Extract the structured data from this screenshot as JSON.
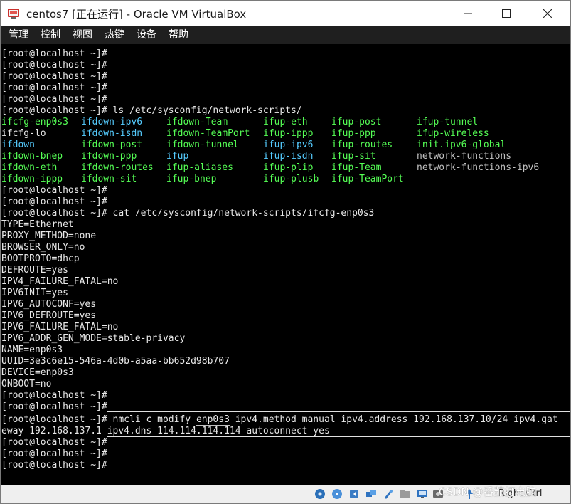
{
  "window": {
    "title": "centos7 [正在运行] - Oracle VM VirtualBox"
  },
  "menu": [
    "管理",
    "控制",
    "视图",
    "热键",
    "设备",
    "帮助"
  ],
  "terminal": {
    "prompt": "[root@localhost ~]#",
    "cmd_ls": "[root@localhost ~]# ls /etc/sysconfig/network-scripts/",
    "ls_rows": [
      [
        "ifcfg-enp0s3",
        "ifdown-ipv6",
        "ifdown-Team",
        "ifup-eth",
        "ifup-post",
        "ifup-tunnel"
      ],
      [
        "ifcfg-lo",
        "ifdown-isdn",
        "ifdown-TeamPort",
        "ifup-ippp",
        "ifup-ppp",
        "ifup-wireless"
      ],
      [
        "ifdown",
        "ifdown-post",
        "ifdown-tunnel",
        "ifup-ipv6",
        "ifup-routes",
        "init.ipv6-global"
      ],
      [
        "ifdown-bnep",
        "ifdown-ppp",
        "ifup",
        "ifup-isdn",
        "ifup-sit",
        "network-functions"
      ],
      [
        "ifdown-eth",
        "ifdown-routes",
        "ifup-aliases",
        "ifup-plip",
        "ifup-Team",
        "network-functions-ipv6"
      ],
      [
        "ifdown-ippp",
        "ifdown-sit",
        "ifup-bnep",
        "ifup-plusb",
        "ifup-TeamPort",
        ""
      ]
    ],
    "cmd_cat": "[root@localhost ~]# cat /etc/sysconfig/network-scripts/ifcfg-enp0s3",
    "cfg_lines": [
      "TYPE=Ethernet",
      "PROXY_METHOD=none",
      "BROWSER_ONLY=no",
      "BOOTPROTO=dhcp",
      "DEFROUTE=yes",
      "IPV4_FAILURE_FATAL=no",
      "IPV6INIT=yes",
      "IPV6_AUTOCONF=yes",
      "IPV6_DEFROUTE=yes",
      "IPV6_FAILURE_FATAL=no",
      "IPV6_ADDR_GEN_MODE=stable-privacy",
      "NAME=enp0s3",
      "UUID=3e3c6e15-546a-4d0b-a5aa-bb652d98b707",
      "DEVICE=enp0s3",
      "ONBOOT=no"
    ],
    "nmcli_prefix": "[root@localhost ~]# nmcli c modify ",
    "nmcli_hl": "enp0s3",
    "nmcli_rest": " ipv4.method manual ipv4.address 192.168.137.10/24 ipv4.gat",
    "nmcli_cont": "eway 192.168.137.1 ipv4.dns 114.114.114.114 autoconnect yes"
  },
  "statusbar": {
    "right_key": "Right Ctrl"
  },
  "watermark": "CSDN @番茄打电脑",
  "colors": {
    "file_green": "#55ff55",
    "file_cyan": "#55ccff",
    "terminal_bg": "#000000",
    "menubar_bg": "#1f1f1f"
  }
}
